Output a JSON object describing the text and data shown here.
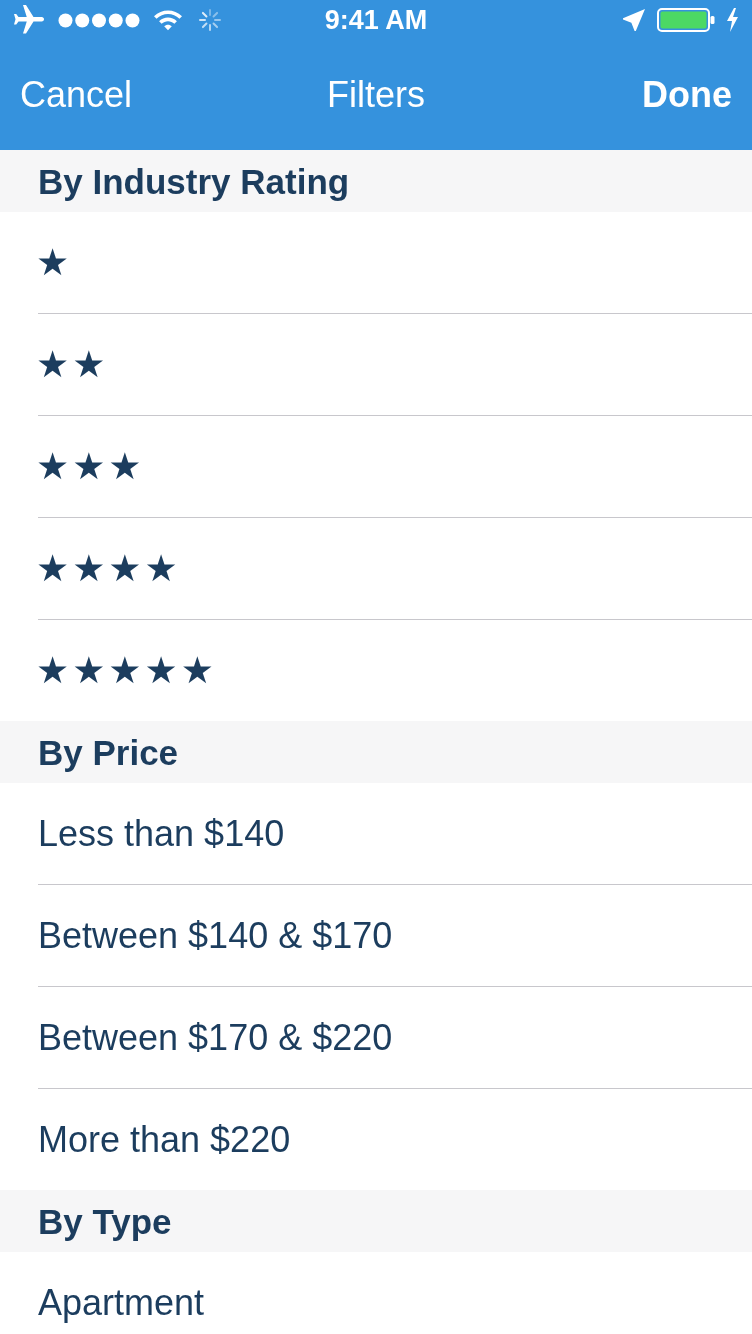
{
  "status_bar": {
    "time": "9:41 AM"
  },
  "nav_bar": {
    "left_button": "Cancel",
    "title": "Filters",
    "right_button": "Done"
  },
  "sections": [
    {
      "title": "By Industry Rating",
      "items": [
        {
          "kind": "rating",
          "label": "★",
          "selected": false
        },
        {
          "kind": "rating",
          "label": "★★",
          "selected": false
        },
        {
          "kind": "rating",
          "label": "★★★",
          "selected": false
        },
        {
          "kind": "rating",
          "label": "★★★★",
          "selected": false
        },
        {
          "kind": "rating",
          "label": "★★★★★",
          "selected": false
        }
      ]
    },
    {
      "title": "By Price",
      "items": [
        {
          "kind": "text",
          "label": "Less than $140",
          "selected": false
        },
        {
          "kind": "text",
          "label": "Between $140 & $170",
          "selected": false
        },
        {
          "kind": "text",
          "label": "Between $170 & $220",
          "selected": false
        },
        {
          "kind": "text",
          "label": "More than $220",
          "selected": false
        }
      ]
    },
    {
      "title": "By Type",
      "items": [
        {
          "kind": "text",
          "label": "Apartment",
          "selected": false
        }
      ]
    }
  ]
}
